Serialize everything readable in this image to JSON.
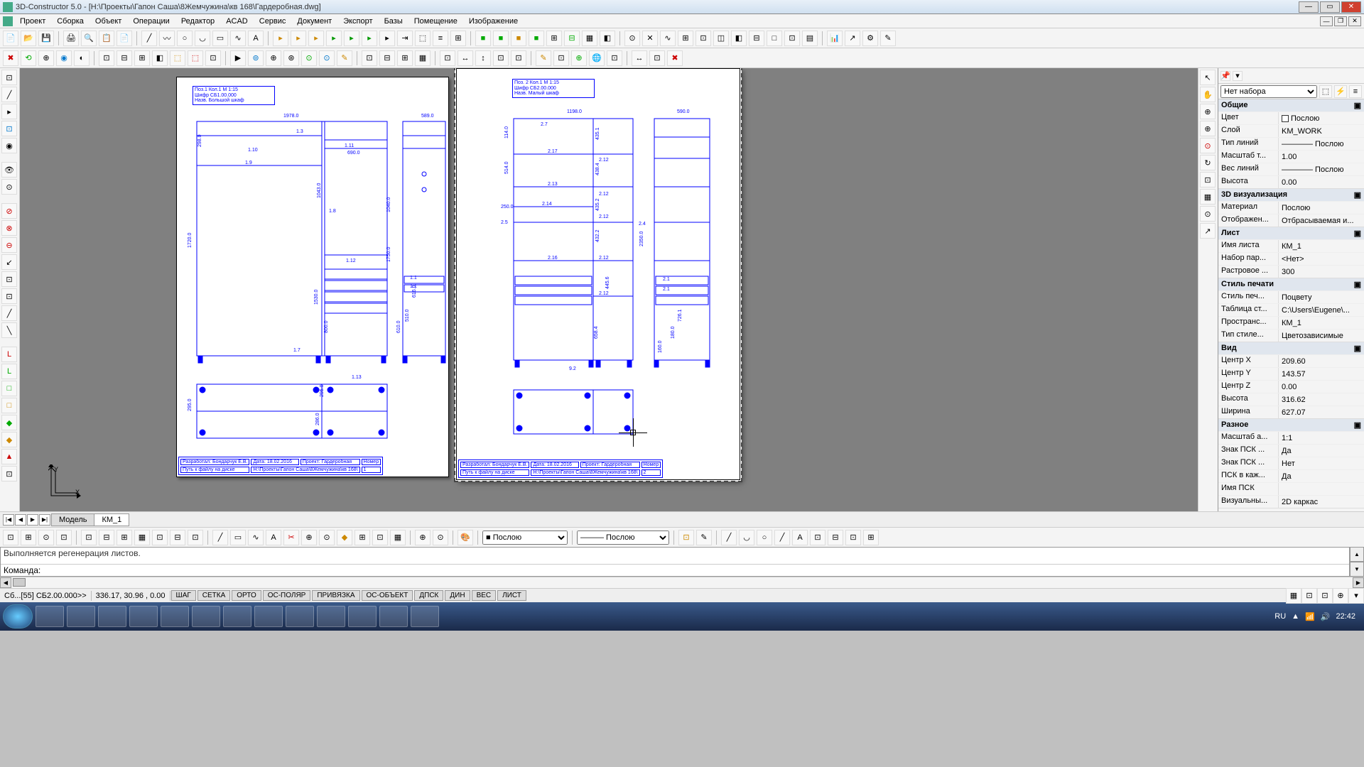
{
  "title": "3D-Constructor 5.0 - [Н:\\Проекты\\Гапон Саша\\8Жемчужина\\кв 168\\Гардеробная.dwg]",
  "menu": [
    "Проект",
    "Сборка",
    "Объект",
    "Операции",
    "Редактор",
    "ACAD",
    "Сервис",
    "Документ",
    "Экспорт",
    "Базы",
    "Помещение",
    "Изображение"
  ],
  "tabs": {
    "nav": [
      "|◀",
      "◀",
      "▶",
      "▶|"
    ],
    "items": [
      "Модель",
      "КМ_1"
    ],
    "active": "КМ_1"
  },
  "layer_combo": "Послою",
  "ltype_combo": "Послою",
  "props": {
    "selector": "Нет набора",
    "groups": [
      {
        "name": "Общие",
        "rows": [
          {
            "k": "Цвет",
            "v": "Послою",
            "sw": "#fff"
          },
          {
            "k": "Слой",
            "v": "KM_WORK"
          },
          {
            "k": "Тип линий",
            "v": "———— Послою"
          },
          {
            "k": "Масштаб т...",
            "v": "1.00"
          },
          {
            "k": "Вес линий",
            "v": "———— Послою"
          },
          {
            "k": "Высота",
            "v": "0.00"
          }
        ]
      },
      {
        "name": "3D визуализация",
        "rows": [
          {
            "k": "Материал",
            "v": "Послою"
          },
          {
            "k": "Отображен...",
            "v": "Отбрасываемая и..."
          }
        ]
      },
      {
        "name": "Лист",
        "rows": [
          {
            "k": "Имя листа",
            "v": "КМ_1"
          },
          {
            "k": "Набор пар...",
            "v": "<Нет>"
          },
          {
            "k": "Растровое ...",
            "v": "300"
          }
        ]
      },
      {
        "name": "Стиль печати",
        "rows": [
          {
            "k": "Стиль печ...",
            "v": "Поцвету"
          },
          {
            "k": "Таблица ст...",
            "v": "C:\\Users\\Eugene\\..."
          },
          {
            "k": "Пространс...",
            "v": "КМ_1"
          },
          {
            "k": "Тип стиле...",
            "v": "Цветозависимые"
          }
        ]
      },
      {
        "name": "Вид",
        "rows": [
          {
            "k": "Центр X",
            "v": "209.60"
          },
          {
            "k": "Центр Y",
            "v": "143.57"
          },
          {
            "k": "Центр Z",
            "v": "0.00"
          },
          {
            "k": "Высота",
            "v": "316.62"
          },
          {
            "k": "Ширина",
            "v": "627.07"
          }
        ]
      },
      {
        "name": "Разное",
        "rows": [
          {
            "k": "Масштаб а...",
            "v": "1:1"
          },
          {
            "k": "Знак ПСК ...",
            "v": "Да"
          },
          {
            "k": "Знак ПСК ...",
            "v": "Нет"
          },
          {
            "k": "ПСК в каж...",
            "v": "Да"
          },
          {
            "k": "Имя ПСК",
            "v": ""
          },
          {
            "k": "Визуальны...",
            "v": "2D каркас"
          }
        ]
      }
    ]
  },
  "cmd": {
    "history": "Выполняется регенерация листов.",
    "prompt": "Команда:",
    "value": ""
  },
  "status": {
    "left": [
      "Сб...[55] СБ2.00.000>>",
      "336.17, 30.96 , 0.00"
    ],
    "btns": [
      "ШАГ",
      "СЕТКА",
      "ОРТО",
      "ОС-ПОЛЯР",
      "ПРИВЯЗКА",
      "ОС-ОБЪЕКТ",
      "ДПСК",
      "ДИН",
      "ВЕС",
      "ЛИСТ"
    ]
  },
  "sheet1": {
    "tb": [
      "Поз.1        Кол.1   М 1:15",
      "Шифр СБ1.00.000",
      "Назв. Большой шкаф"
    ],
    "dims": [
      "1978.0",
      "589.0",
      "1.3",
      "1.10",
      "1.11",
      "690.0",
      "1.9",
      "1.8",
      "1043.0",
      "1040.0",
      "1530.0",
      "1720.0",
      "1.12",
      "1750.0",
      "800.0",
      "1.7",
      "610.0",
      "510.0",
      "616.0",
      "1.1",
      "1.1",
      "298.0",
      "295.0",
      "286.0",
      "295.0",
      "1.13"
    ],
    "footer": {
      "dev_l": "Разработал:",
      "dev_v": "Бондарчук Е.В.",
      "date_l": "Дата:",
      "date_v": "18.02.2016",
      "proj_l": "Проект:",
      "proj_v": "Гардеробная",
      "num_l": "Номер",
      "path_l": "Путь к файлу на диске",
      "path_v": "Н:\\Проекты\\Гапон Саша\\8Жемчужина\\кв 168\\",
      "num_v": "1"
    }
  },
  "sheet2": {
    "tb": [
      "Поз. 2        Кол.1   М 1:15",
      "Шифр СБ2.00.000",
      "Назв. Малый шкаф"
    ],
    "dims": [
      "1198.0",
      "590.0",
      "2.7",
      "114.0",
      "2.17",
      "435.1",
      "2.12",
      "514.0",
      "2.13",
      "438.4",
      "2.12",
      "250.0",
      "2.14",
      "2.12",
      "2.5",
      "2.4",
      "2.16",
      "432.2",
      "435.2",
      "2.12",
      "2.12",
      "445.6",
      "658.4",
      "9.2",
      "2350.0",
      "180.0",
      "160.0",
      "726.1",
      "2.1",
      "2.1"
    ],
    "footer": {
      "dev_l": "Разработал:",
      "dev_v": "Бондарчук Е.В.",
      "date_l": "Дата:",
      "date_v": "18.02.2016",
      "proj_l": "Проект:",
      "proj_v": "Гардеробная",
      "num_l": "Номер",
      "path_l": "Путь к файлу на диске",
      "path_v": "Н:\\Проекты\\Гапон Саша\\8Жемчужина\\кв 168\\",
      "num_v": "2"
    }
  },
  "tray": {
    "lang": "RU",
    "time": "22:42"
  }
}
